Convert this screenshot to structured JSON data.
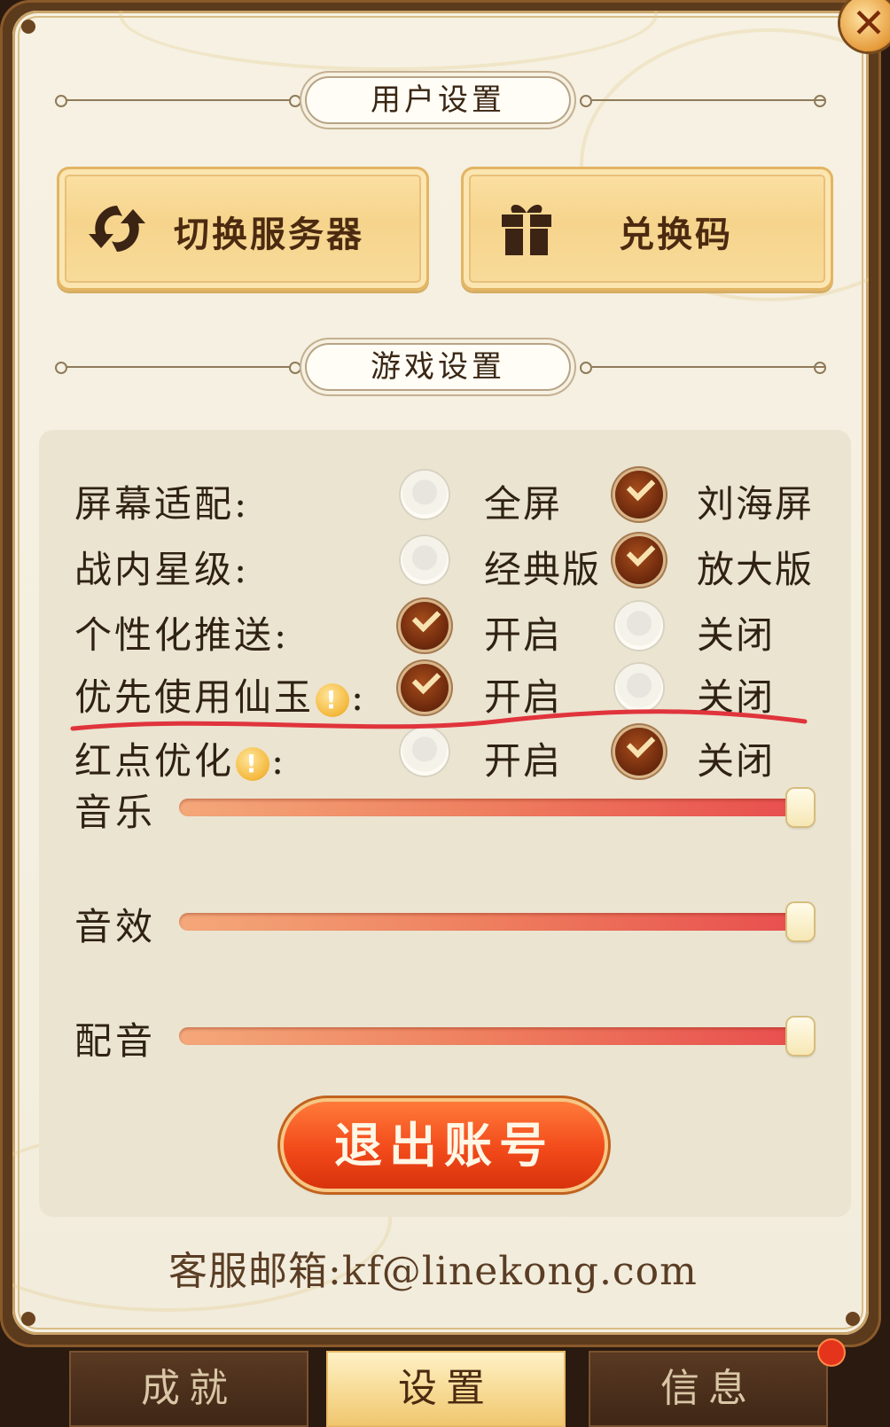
{
  "user_section": {
    "title": "用户设置"
  },
  "switch_server": {
    "label": "切换服务器",
    "icon": "refresh-icon"
  },
  "redeem_code": {
    "label": "兑换码",
    "icon": "gift-icon"
  },
  "game_section": {
    "title": "游戏设置"
  },
  "settings": [
    {
      "label": "屏幕适配:",
      "options": [
        "全屏",
        "刘海屏"
      ],
      "selected": 1,
      "warn": false
    },
    {
      "label": "战内星级:",
      "options": [
        "经典版",
        "放大版"
      ],
      "selected": 1,
      "warn": false
    },
    {
      "label": "个性化推送:",
      "options": [
        "开启",
        "关闭"
      ],
      "selected": 0,
      "warn": false
    },
    {
      "label": "优先使用仙玉",
      "options": [
        "开启",
        "关闭"
      ],
      "selected": 0,
      "warn": true
    },
    {
      "label": "红点优化",
      "options": [
        "开启",
        "关闭"
      ],
      "selected": 1,
      "warn": true
    }
  ],
  "sliders": [
    {
      "label": "音乐",
      "value": 1.0
    },
    {
      "label": "音效",
      "value": 1.0
    },
    {
      "label": "配音",
      "value": 1.0
    }
  ],
  "logout_label": "退出账号",
  "email": "客服邮箱:kf@linekong.com",
  "tabs": [
    {
      "label": "成就",
      "active": false
    },
    {
      "label": "设置",
      "active": true
    },
    {
      "label": "信息",
      "active": false
    }
  ],
  "colors": {
    "accent": "#f24a1a",
    "text": "#2f2214",
    "panel": "#f6f1e2"
  }
}
